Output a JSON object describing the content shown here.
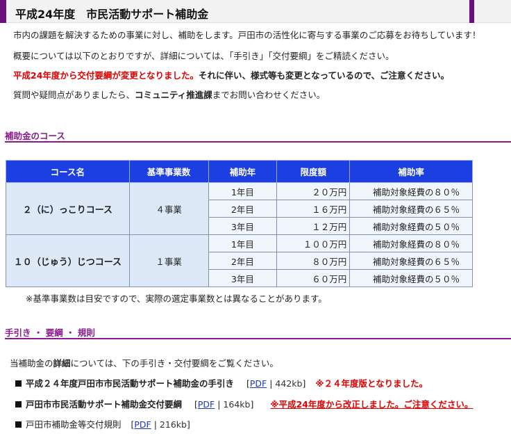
{
  "title": "平成24年度　市民活動サポート補助金",
  "intro": {
    "line1": "市内の課題を解決するための事業に対し、補助をします。戸田市の活性化に寄与する事業のご応募をお待ちしています！",
    "line2": "概要については以下のとおりですが、詳細については、「手引き」「交付要綱」をご精読ください。",
    "line3_red": "平成24年度から交付要綱が変更となりました。",
    "line3_bold": "それに伴い、様式等も変更となっているので、ご注意ください。",
    "line4_pre": "質問や疑問点がありましたら、",
    "line4_bold": "コミュニティ推進課",
    "line4_post": "までお問い合わせください。"
  },
  "section_course": {
    "heading": "補助金のコース"
  },
  "table": {
    "headers": [
      "コース名",
      "基準事業数",
      "補助年",
      "限度額",
      "補助率"
    ],
    "courses": [
      {
        "name": "２（に）っこりコース",
        "count": "４事業",
        "rows": [
          {
            "year": "1年目",
            "limit": "２０万円",
            "rate": "補助対象経費の８０％"
          },
          {
            "year": "2年目",
            "limit": "１６万円",
            "rate": "補助対象経費の６５％"
          },
          {
            "year": "3年目",
            "limit": "１２万円",
            "rate": "補助対象経費の５０％"
          }
        ]
      },
      {
        "name": "１０（じゅう）じつコース",
        "count": "１事業",
        "rows": [
          {
            "year": "1年目",
            "limit": "１００万円",
            "rate": "補助対象経費の８０％"
          },
          {
            "year": "2年目",
            "limit": "８０万円",
            "rate": "補助対象経費の６５％"
          },
          {
            "year": "3年目",
            "limit": "６０万円",
            "rate": "補助対象経費の５０％"
          }
        ]
      }
    ],
    "note": "※基準事業数は目安ですので、実際の選定事業数とは異なることがあります。"
  },
  "section_docs": {
    "heading": "手引き ・ 要綱 ・ 規則",
    "intro_pre": "当補助金の",
    "intro_bold": "詳細",
    "intro_post": "については、下の手引き・交付要綱をご覧ください。",
    "items": [
      {
        "label": "平成２４年度戸田市市民活動サポート補助金の手引き",
        "link": "PDF",
        "size": "442kb",
        "remark": "※２４年度版となりました。"
      },
      {
        "label": "戸田市市民活動サポート補助金交付要綱",
        "link": "PDF",
        "size": "164kb",
        "remark": "※平成24年度から改正しました。ご注意ください。"
      },
      {
        "label": "戸田市補助金等交付規則",
        "link": "PDF",
        "size": "216kb",
        "remark": ""
      }
    ]
  },
  "colors": {
    "accent": "#6a0f7c",
    "header_blue": "#1b3fe0",
    "cell_bg": "#eaf2fb",
    "alert_red": "#e00000",
    "link_blue": "#1a35c8"
  }
}
